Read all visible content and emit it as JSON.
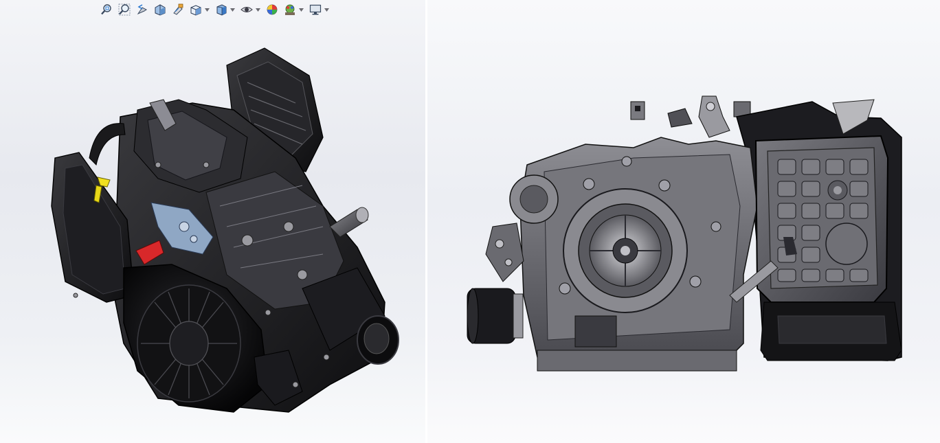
{
  "heads_up_toolbar": {
    "buttons": [
      {
        "name": "zoom-to-fit-button",
        "icon": "zoom-to-fit-icon",
        "has_dropdown": false
      },
      {
        "name": "zoom-to-area-button",
        "icon": "zoom-to-area-icon",
        "has_dropdown": false
      },
      {
        "name": "previous-view-button",
        "icon": "previous-view-icon",
        "has_dropdown": false
      },
      {
        "name": "section-view-button",
        "icon": "section-view-icon",
        "has_dropdown": false
      },
      {
        "name": "dynamic-annotation-button",
        "icon": "dynamic-annotation-icon",
        "has_dropdown": false
      },
      {
        "name": "view-orientation-button",
        "icon": "view-orientation-icon",
        "has_dropdown": true
      },
      {
        "name": "display-style-button",
        "icon": "display-style-icon",
        "has_dropdown": true
      },
      {
        "name": "hide-show-items-button",
        "icon": "hide-show-icon",
        "has_dropdown": true
      },
      {
        "name": "edit-appearance-button",
        "icon": "edit-appearance-icon",
        "has_dropdown": false
      },
      {
        "name": "apply-scene-button",
        "icon": "apply-scene-icon",
        "has_dropdown": true
      },
      {
        "name": "view-settings-button",
        "icon": "monitor-icon",
        "has_dropdown": true
      }
    ]
  },
  "viewports": {
    "left": {
      "view": "isometric",
      "model": "engine-assembly"
    },
    "right": {
      "view": "side",
      "model": "engine-assembly"
    }
  },
  "colors": {
    "viewport_bg_top": "#f4f5f8",
    "viewport_bg_mid": "#e7e9ef",
    "model_dark": "#1c1c1e",
    "model_mid": "#5a5a5e",
    "model_light": "#9a9aa0",
    "bracket_yellow": "#f0e020",
    "bracket_red": "#d8282a",
    "bracket_blue": "#8fa7c4",
    "toolbar_accent_blue": "#2f7bd0"
  }
}
